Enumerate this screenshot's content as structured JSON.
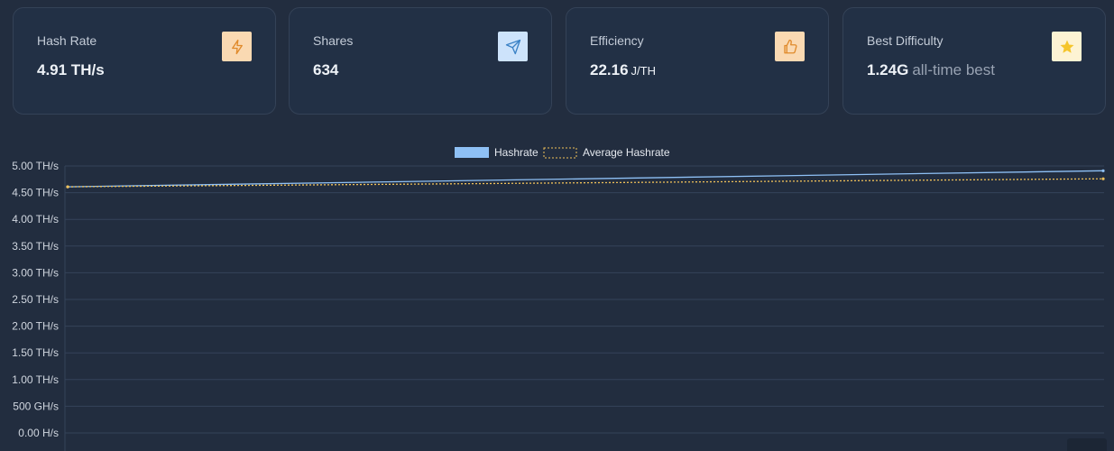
{
  "cards": [
    {
      "label": "Hash Rate",
      "value": "4.91 TH/s",
      "icon": "lightning-icon"
    },
    {
      "label": "Shares",
      "value": "634",
      "icon": "send-icon"
    },
    {
      "label": "Efficiency",
      "value": "22.16",
      "unit": "J/TH",
      "icon": "thumbs-up-icon"
    },
    {
      "label": "Best Difficulty",
      "value": "1.24G",
      "suffix": "all-time best",
      "icon": "star-icon"
    }
  ],
  "colors": {
    "hashrate": "#8ec0f5",
    "average": "#f0c15a",
    "lightning": "#e08a2b",
    "send": "#3b82c6",
    "thumbs": "#e08a2b",
    "star": "#f5c52b"
  },
  "chart_data": {
    "type": "line",
    "series": [
      {
        "name": "Hashrate",
        "values": [
          4.61,
          4.91
        ]
      },
      {
        "name": "Average Hashrate",
        "values": [
          4.61,
          4.76
        ]
      }
    ],
    "ylim": [
      0,
      5.0
    ],
    "ytick_values": [
      0,
      0.5,
      1.0,
      1.5,
      2.0,
      2.5,
      3.0,
      3.5,
      4.0,
      4.5,
      5.0
    ],
    "ytick_labels": [
      "0.00 H/s",
      "500 GH/s",
      "1.00 TH/s",
      "1.50 TH/s",
      "2.00 TH/s",
      "2.50 TH/s",
      "3.00 TH/s",
      "3.50 TH/s",
      "4.00 TH/s",
      "4.50 TH/s",
      "5.00 TH/s"
    ],
    "legend_position": "top-center",
    "grid": true
  }
}
